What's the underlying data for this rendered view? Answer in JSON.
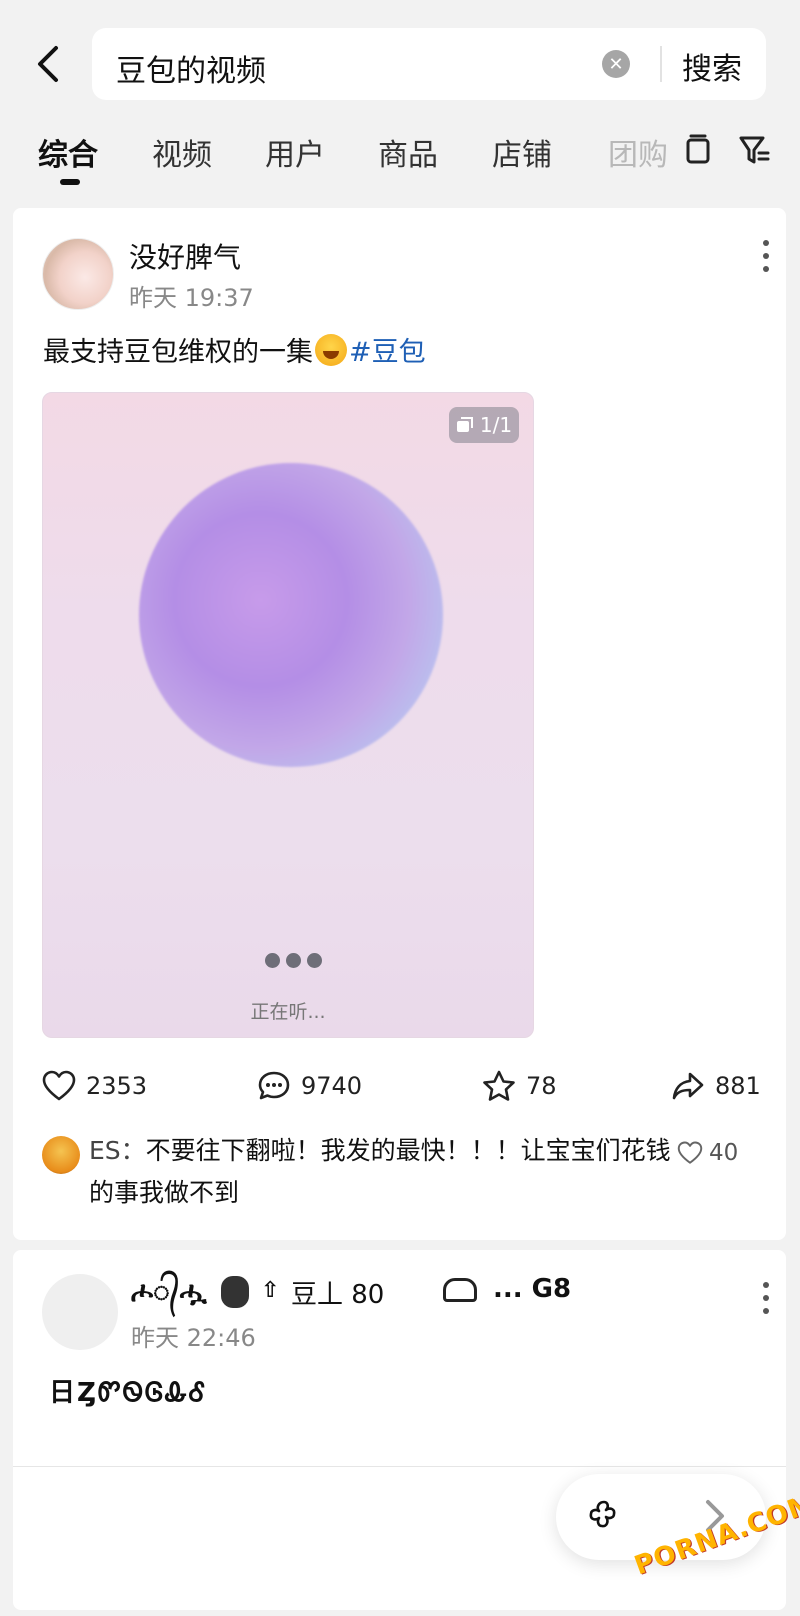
{
  "search": {
    "query": "豆包的视频",
    "submit_label": "搜索"
  },
  "tabs": [
    {
      "label": "综合"
    },
    {
      "label": "视频"
    },
    {
      "label": "用户"
    },
    {
      "label": "商品"
    },
    {
      "label": "店铺"
    },
    {
      "label": "团购"
    }
  ],
  "post1": {
    "author": "没好脾气",
    "time": "昨天 19:37",
    "caption": "最支持豆包维权的一集",
    "hashtag": "#豆包",
    "media": {
      "page_indicator": "1/1",
      "status_text": "正在听..."
    },
    "stats": {
      "likes": "2353",
      "comments": "9740",
      "favorites": "78",
      "shares": "881"
    },
    "top_comment": {
      "user": "ES：",
      "text": "不要往下翻啦！我发的最快！！！让宝宝们花钱的事我做不到",
      "likes": "40"
    }
  },
  "post2": {
    "author": "ሖ᭄ሗ",
    "author_extra": "豆丄 80",
    "author_tail": "...  G8",
    "time": "昨天 22:46",
    "caption": "日ȤᏛᏫᎶᎲᎴ"
  },
  "watermark": "PORNA.COM",
  "colors": {
    "hashtag": "#1e5fb5",
    "background": "#f2f2f2",
    "card": "#ffffff"
  }
}
